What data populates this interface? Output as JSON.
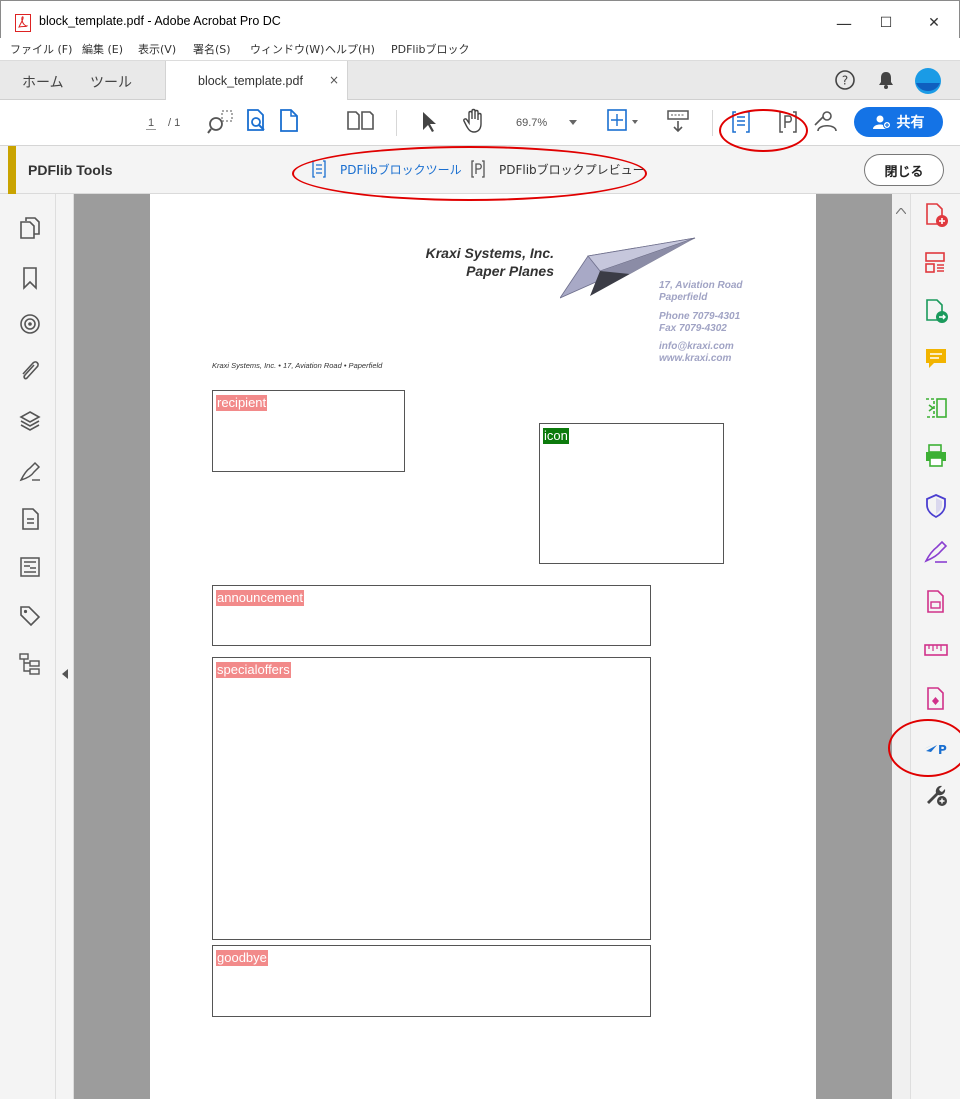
{
  "window": {
    "title": "block_template.pdf - Adobe Acrobat Pro DC",
    "minimize": "—",
    "maximize": "☐",
    "close": "✕"
  },
  "menu": [
    "ファイル (F)",
    "編集 (E)",
    "表示(V)",
    "署名(S)",
    "ウィンドウ(W)",
    "ヘルプ(H)",
    "PDFlibブロック"
  ],
  "tabs": {
    "home": "ホーム",
    "tools": "ツール",
    "document": "block_template.pdf",
    "close": "×"
  },
  "toolbar": {
    "page_current": "1",
    "page_total": "/ 1",
    "zoom": "69.7%",
    "share_label": "共有"
  },
  "pdflib_bar": {
    "name": "PDFlib Tools",
    "block_tool": "PDFlibブロックツール",
    "block_preview": "PDFlibブロックプレビュー",
    "close": "閉じる"
  },
  "letterhead": {
    "company": "Kraxi Systems, Inc.",
    "product": "Paper Planes",
    "address1": "17, Aviation Road",
    "address2": "Paperfield",
    "phone": "Phone 7079-4301",
    "fax": "Fax 7079-4302",
    "email": "info@kraxi.com",
    "web": "www.kraxi.com",
    "sender_line": "Kraxi Systems, Inc. • 17, Aviation Road • Paperfield"
  },
  "blocks": {
    "recipient": "recipient",
    "icon": "icon",
    "announcement": "announcement",
    "specialoffers": "specialoffers",
    "goodbye": "goodbye"
  },
  "colors": {
    "accent_blue": "#1473e6",
    "block_label_bg": "#f28a8a",
    "image_block_bg": "#0c7a0c",
    "annotation_red": "#e00000"
  }
}
